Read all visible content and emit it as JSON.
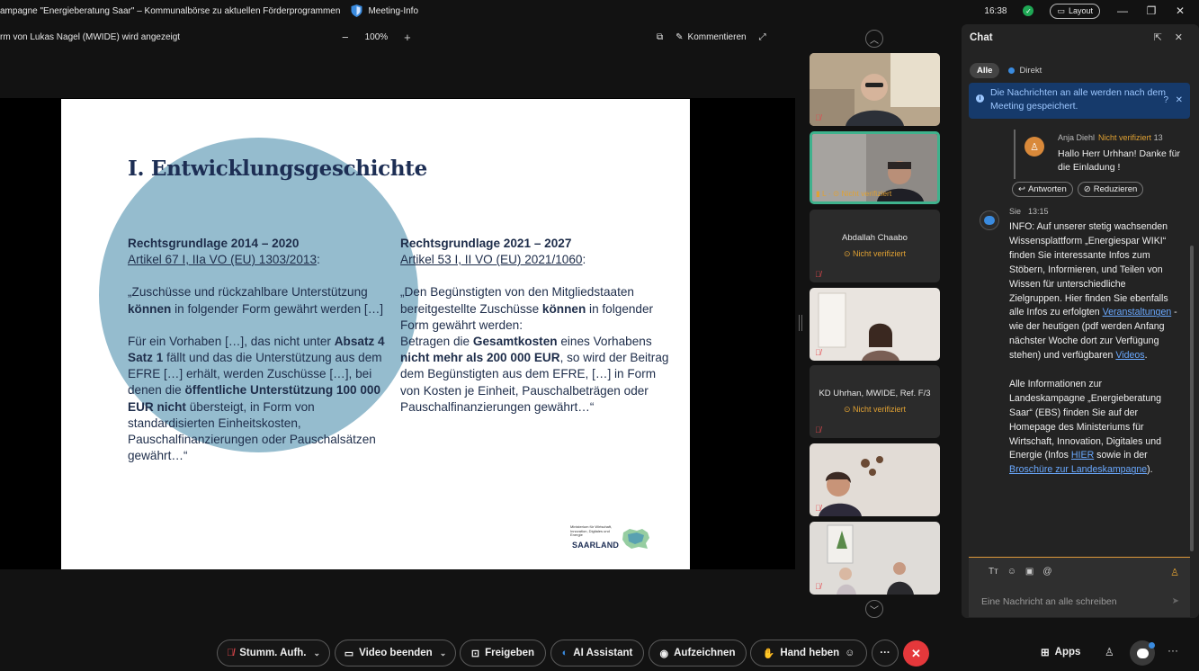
{
  "titlebar": {
    "title": "ampagne \"Energieberatung Saar\" – Kommunalbörse zu aktuellen Förderprogrammen",
    "meeting_info": "Meeting-Info",
    "time": "16:38",
    "layout": "Layout"
  },
  "sharebar": {
    "label": "rm von Lukas Nagel (MWIDE) wird angezeigt",
    "zoom_minus": "−",
    "zoom": "100%",
    "zoom_plus": "+",
    "comment": "Kommentieren"
  },
  "slide": {
    "title": "I. Entwicklungsgeschichte",
    "left": {
      "heading": "Rechtsgrundlage 2014 – 2020",
      "ref": "Artikel 67 I, IIa VO (EU) 1303/2013",
      "ref_colon": ":",
      "p1_a": "„Zuschüsse und rückzahlbare Unterstützung ",
      "p1_b": "können",
      "p1_c": " in folgender Form gewährt werden […]",
      "p2_a": "Für ein Vorhaben […], das nicht unter ",
      "p2_b": "Absatz 4 Satz 1",
      "p2_c": " fällt und das die Unterstützung aus dem EFRE […] erhält, werden Zuschüsse […], bei denen die ",
      "p2_d": "öffentliche Unterstützung 100 000 EUR nicht",
      "p2_e": " übersteigt, in Form von standardisierten Einheitskosten, Pauschalfinanzierungen oder Pauschalsätzen gewährt…“"
    },
    "right": {
      "heading": "Rechtsgrundlage 2021 – 2027",
      "ref": "Artikel 53 I, II VO (EU) 2021/1060",
      "ref_colon": ":",
      "p1_a": "„Den Begünstigten von den Mitgliedstaaten bereitgestellte Zuschüsse ",
      "p1_b": "können",
      "p1_c": " in folgender Form gewährt werden:",
      "p1_d": "Betragen die ",
      "p1_e": "Gesamtkosten",
      "p1_f": " eines Vorhabens ",
      "p1_g": "nicht mehr als 200 000 EUR",
      "p1_h": ", so wird der Beitrag dem Begünstigten aus dem EFRE, […] in Form von Kosten je Einheit, Pauschalbeträgen oder Pauschalfinanzierungen gewährt…“"
    },
    "logo_ministry": "Ministerium für Wirtschaft, Innovation, Digitales und Energie",
    "logo_saarland": "SAARLAND"
  },
  "participants": [
    {
      "name": "",
      "status": ""
    },
    {
      "name": "L",
      "status": "Nicht verifiziert"
    },
    {
      "name": "Abdallah Chaabo",
      "status": "Nicht verifiziert"
    },
    {
      "name": "",
      "status": ""
    },
    {
      "name": "KD Uhrhan, MWIDE, Ref. F/3",
      "status": "Nicht verifiziert"
    },
    {
      "name": "",
      "status": ""
    },
    {
      "name": "",
      "status": ""
    }
  ],
  "chat": {
    "title": "Chat",
    "tab_all": "Alle",
    "tab_direct": "Direkt",
    "notice": "Die Nachrichten an alle werden nach dem Meeting gespeichert.",
    "quoted": {
      "author": "Anja Diehl",
      "unverified": "Nicht verifiziert",
      "time_cut": "13",
      "text": "Hallo Herr Urhhan! Danke für die Einladung !"
    },
    "reply_button": "Antworten",
    "reduce_button": "Reduzieren",
    "mine": {
      "author": "Sie",
      "time": "13:15",
      "p1_a": "INFO: Auf unserer stetig wachsenden Wissensplattform „Energiespar WIKI“ finden Sie interessante Infos zum Stöbern, Informieren, und Teilen von Wissen für unterschiedliche Zielgruppen. Hier finden Sie ebenfalls alle Infos zu erfolgten ",
      "p1_link1": "Veranstaltungen",
      "p1_b": " - wie der heutigen (pdf werden Anfang nächster Woche dort zur Verfügung stehen) und verfügbaren ",
      "p1_link2": "Videos",
      "p1_c": ".",
      "p2_a": "Alle Informationen zur Landeskampagne „Energieberatung Saar“ (EBS) finden Sie auf der Homepage des Ministeriums für Wirtschaft, Innovation, Digitales und Energie (Infos ",
      "p2_link1": "HIER",
      "p2_b": " sowie in der ",
      "p2_link2": "Broschüre zur Landeskampagne",
      "p2_c": ")."
    },
    "placeholder": "Eine Nachricht an alle schreiben"
  },
  "controls": {
    "mute": "Stumm. Aufh.",
    "video": "Video beenden",
    "share": "Freigeben",
    "ai": "AI Assistant",
    "record": "Aufzeichnen",
    "hand": "Hand heben",
    "apps": "Apps"
  }
}
